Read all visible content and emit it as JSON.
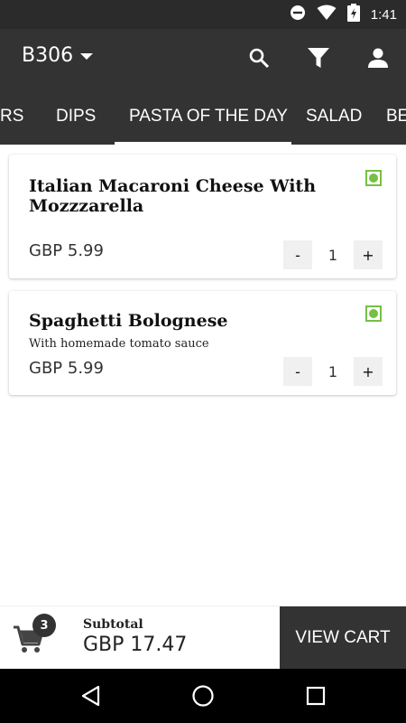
{
  "status_bar": {
    "time": "1:41",
    "icons": [
      "do-not-disturb-icon",
      "wifi-icon",
      "battery-charging-icon"
    ]
  },
  "app_bar": {
    "table_name": "B306",
    "actions": [
      "search-icon",
      "filter-icon",
      "profile-icon"
    ]
  },
  "tabs": [
    {
      "label": "RS",
      "active": false
    },
    {
      "label": "DIPS",
      "active": false
    },
    {
      "label": "PASTA OF THE DAY",
      "active": true
    },
    {
      "label": "SALAD",
      "active": false
    },
    {
      "label": "BE",
      "active": false
    }
  ],
  "items": [
    {
      "name": "Italian Macaroni Cheese With Mozzzarella",
      "description": "",
      "price": "GBP 5.99",
      "quantity": "1",
      "veg": true,
      "minus_label": "-",
      "plus_label": "+"
    },
    {
      "name": "Spaghetti Bolognese",
      "description": "With homemade tomato sauce",
      "price": "GBP 5.99",
      "quantity": "1",
      "veg": true,
      "minus_label": "-",
      "plus_label": "+"
    }
  ],
  "cart": {
    "count": "3",
    "subtotal_label": "Subtotal",
    "subtotal_value": "GBP 17.47",
    "view_cart_label": "VIEW CART"
  },
  "colors": {
    "app_bar": "#333333",
    "veg_green": "#76c043",
    "nav_bar": "#000000"
  }
}
